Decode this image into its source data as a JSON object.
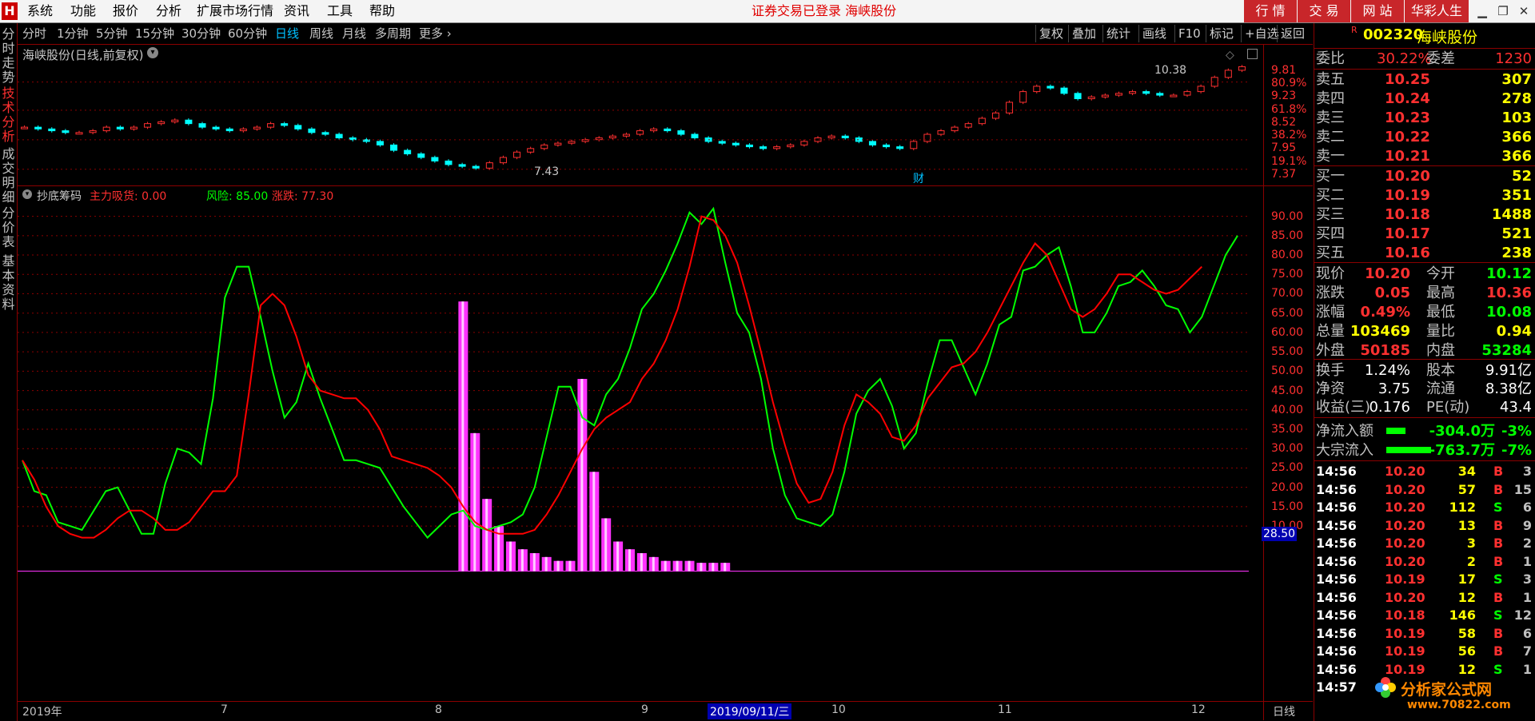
{
  "menu": [
    "系统",
    "功能",
    "报价",
    "分析",
    "扩展市场行情",
    "资讯",
    "工具",
    "帮助"
  ],
  "title_notice": "证券交易已登录  海峡股份",
  "top_buttons": [
    "行 情",
    "交 易",
    "网 站",
    "华彩人生"
  ],
  "periods": [
    "分时",
    "1分钟",
    "5分钟",
    "15分钟",
    "30分钟",
    "60分钟",
    "日线",
    "周线",
    "月线",
    "多周期",
    "更多 ›"
  ],
  "tool_buttons": [
    "复权",
    "叠加",
    "统计",
    "画线",
    "F10",
    "标记",
    "+自选",
    "返回"
  ],
  "left_tabs": [
    "分时走势",
    "技术分析",
    "成交明细",
    "分价表",
    "基本资料"
  ],
  "upper_chart": {
    "title": "海峡股份(日线,前复权)",
    "high_label": "10.38",
    "low_label": "7.43",
    "marker": "财",
    "axis": [
      "9.81",
      "80.9%",
      "9.23",
      "61.8%",
      "8.52",
      "38.2%",
      "7.95",
      "19.1%",
      "7.37"
    ]
  },
  "indicator": {
    "name": "抄底筹码",
    "main_label": "主力吸货: 0.00",
    "risk_label": "风险: 85.00",
    "rise_label": "涨跌: 77.30",
    "axis": [
      "90.00",
      "85.00",
      "80.00",
      "75.00",
      "70.00",
      "65.00",
      "60.00",
      "55.00",
      "50.00",
      "45.00",
      "40.00",
      "35.00",
      "30.00",
      "25.00",
      "20.00",
      "15.00",
      "10.00"
    ],
    "cursor_value": "28.50"
  },
  "date_axis": {
    "labels": [
      "2019年",
      "7",
      "8",
      "9",
      "10",
      "11",
      "12"
    ],
    "highlight": "2019/09/11/三",
    "period": "日线"
  },
  "stock": {
    "flag": "R",
    "code": "002320",
    "name": "海峡股份"
  },
  "book": {
    "webi_label": "委比",
    "webi_val": "30.22%",
    "wecha_label": "委差",
    "wecha_val": "1230",
    "asks": [
      [
        "卖五",
        "10.25",
        "307"
      ],
      [
        "卖四",
        "10.24",
        "278"
      ],
      [
        "卖三",
        "10.23",
        "103"
      ],
      [
        "卖二",
        "10.22",
        "366"
      ],
      [
        "卖一",
        "10.21",
        "366"
      ]
    ],
    "bids": [
      [
        "买一",
        "10.20",
        "52"
      ],
      [
        "买二",
        "10.19",
        "351"
      ],
      [
        "买三",
        "10.18",
        "1488"
      ],
      [
        "买四",
        "10.17",
        "521"
      ],
      [
        "买五",
        "10.16",
        "238"
      ]
    ]
  },
  "quote": [
    [
      "现价",
      "10.20",
      "今开",
      "10.12"
    ],
    [
      "涨跌",
      "0.05",
      "最高",
      "10.36"
    ],
    [
      "涨幅",
      "0.49%",
      "最低",
      "10.08"
    ],
    [
      "总量",
      "103469",
      "量比",
      "0.94"
    ],
    [
      "外盘",
      "50185",
      "内盘",
      "53284"
    ]
  ],
  "fund": [
    [
      "换手",
      "1.24%",
      "股本",
      "9.91亿"
    ],
    [
      "净资",
      "3.75",
      "流通",
      "8.38亿"
    ],
    [
      "收益(三)",
      "0.176",
      "PE(动)",
      "43.4"
    ]
  ],
  "flows": [
    {
      "label": "净流入额",
      "val": "-304.0万",
      "pct": "-3%",
      "frac": 0.3
    },
    {
      "label": "大宗流入",
      "val": "-763.7万",
      "pct": "-7%",
      "frac": 0.7
    }
  ],
  "ticks": [
    [
      "14:56",
      "10.20",
      "34",
      "B",
      "3"
    ],
    [
      "14:56",
      "10.20",
      "57",
      "B",
      "15"
    ],
    [
      "14:56",
      "10.20",
      "112",
      "S",
      "6"
    ],
    [
      "14:56",
      "10.20",
      "13",
      "B",
      "9"
    ],
    [
      "14:56",
      "10.20",
      "3",
      "B",
      "2"
    ],
    [
      "14:56",
      "10.20",
      "2",
      "B",
      "1"
    ],
    [
      "14:56",
      "10.19",
      "17",
      "S",
      "3"
    ],
    [
      "14:56",
      "10.20",
      "12",
      "B",
      "1"
    ],
    [
      "14:56",
      "10.18",
      "146",
      "S",
      "12"
    ],
    [
      "14:56",
      "10.19",
      "58",
      "B",
      "6"
    ],
    [
      "14:56",
      "10.19",
      "56",
      "B",
      "7"
    ],
    [
      "14:56",
      "10.19",
      "12",
      "S",
      "1"
    ],
    [
      "14:57",
      "",
      "",
      " ",
      ""
    ]
  ],
  "watermark": {
    "line1": "分析家公式网",
    "line2": "www.70822.com"
  },
  "colors": {
    "up": "#ff3030",
    "down": "#00ffff",
    "green": "#00ff00",
    "red": "#ff0000",
    "magenta": "#ff33ff",
    "yellow": "#ffff00",
    "axis": "#8b0000"
  },
  "chart_data": {
    "type": "line",
    "ylim": [
      5,
      95
    ],
    "series": [
      {
        "name": "风险",
        "color": "#00ff00",
        "values": [
          27,
          19,
          18,
          11,
          10,
          9,
          14,
          19,
          20,
          14,
          8,
          8,
          21,
          30,
          29,
          26,
          43,
          69,
          77,
          77,
          64,
          50,
          38,
          42,
          52,
          43,
          35,
          27,
          27,
          26,
          25,
          20,
          15,
          11,
          7,
          10,
          13,
          14,
          10,
          9,
          10,
          11,
          13,
          20,
          33,
          46,
          46,
          38,
          36,
          44,
          48,
          56,
          66,
          70,
          76,
          83,
          91,
          88,
          92,
          78,
          65,
          60,
          48,
          30,
          18,
          12,
          11,
          10,
          13,
          24,
          39,
          45,
          48,
          41,
          30,
          34,
          47,
          58,
          58,
          51,
          44,
          52,
          62,
          64,
          76,
          77,
          80,
          82,
          72,
          60,
          60,
          65,
          72,
          73,
          76,
          72,
          67,
          66,
          60,
          64,
          72,
          80,
          85
        ]
      },
      {
        "name": "涨跌",
        "color": "#ff0000",
        "values": [
          27,
          22,
          15,
          10,
          8,
          7,
          7,
          9,
          12,
          14,
          14,
          12,
          9,
          9,
          11,
          15,
          19,
          19,
          23,
          44,
          67,
          70,
          67,
          59,
          49,
          45,
          44,
          43,
          43,
          40,
          35,
          28,
          27,
          26,
          25,
          23,
          20,
          15,
          11,
          9,
          8,
          8,
          8,
          9,
          13,
          18,
          24,
          30,
          35,
          38,
          40,
          42,
          48,
          52,
          58,
          66,
          77,
          90,
          89,
          85,
          78,
          67,
          55,
          42,
          31,
          21,
          16,
          17,
          24,
          36,
          44,
          42,
          39,
          33,
          32,
          36,
          43,
          47,
          51,
          52,
          55,
          60,
          66,
          72,
          78,
          83,
          80,
          73,
          66,
          64,
          66,
          70,
          75,
          75,
          73,
          71,
          70,
          71,
          74,
          77
        ]
      },
      {
        "name": "主力吸货",
        "color": "#ff33ff",
        "type": "bar",
        "x_start": 37,
        "values": [
          68,
          34,
          17,
          10,
          6,
          4,
          3,
          2,
          1,
          1,
          48,
          24,
          12,
          6,
          4,
          3,
          2,
          1,
          1,
          1,
          0.5,
          0.5,
          0.5
        ]
      }
    ]
  }
}
